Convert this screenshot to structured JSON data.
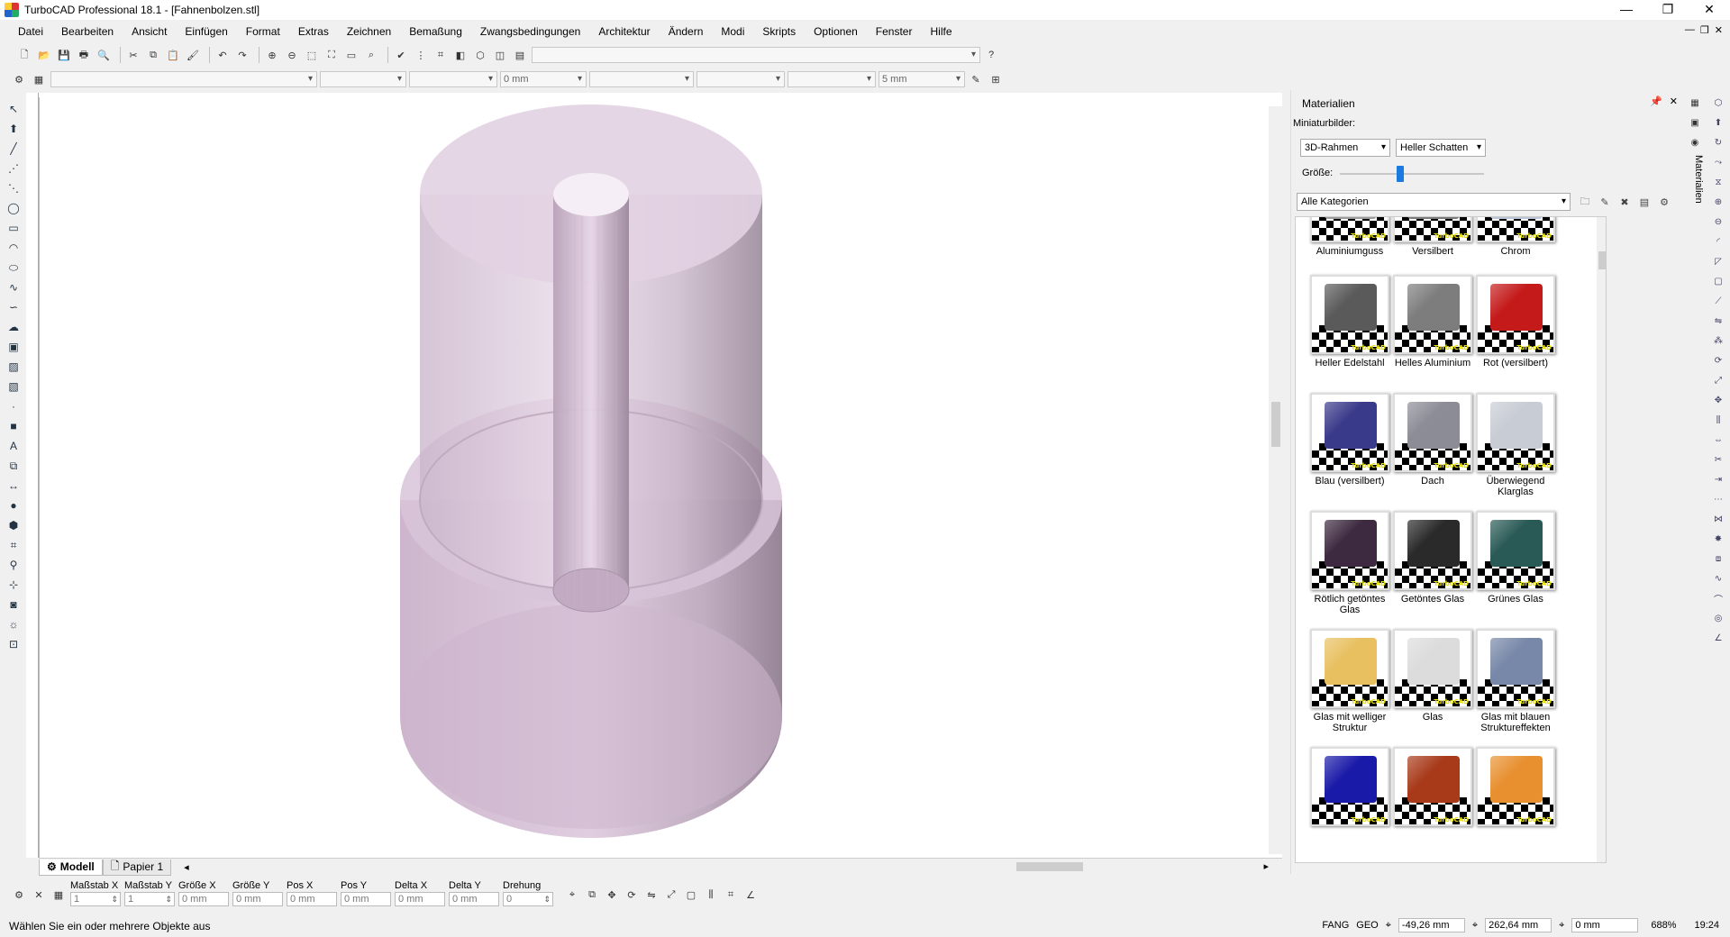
{
  "window": {
    "title": "TurboCAD Professional 18.1 - [Fahnenbolzen.stl]",
    "minimize": "—",
    "maximize": "❐",
    "close": "✕"
  },
  "menu": [
    "Datei",
    "Bearbeiten",
    "Ansicht",
    "Einfügen",
    "Format",
    "Extras",
    "Zeichnen",
    "Bemaßung",
    "Zwangsbedingungen",
    "Architektur",
    "Ändern",
    "Modi",
    "Skripts",
    "Optionen",
    "Fenster",
    "Hilfe"
  ],
  "toolbar2": {
    "offset_value": "0 mm",
    "snap_value": "5 mm"
  },
  "tabs": {
    "model": "Modell",
    "paper": "Papier 1"
  },
  "materials": {
    "title": "Materialien",
    "thumbnails_label": "Miniaturbilder:",
    "frame_option": "3D-Rahmen",
    "shadow_option": "Heller Schatten",
    "size_label": "Größe:",
    "size_fraction": 0.42,
    "category": "Alle Kategorien",
    "vertical_tab": "Materialien",
    "items": [
      {
        "label": "Aluminiumguss",
        "color": "#9a9a9a"
      },
      {
        "label": "Versilbert",
        "color": "#7a7a7a"
      },
      {
        "label": "Chrom",
        "color": "#b8c4d8"
      },
      {
        "label": "Heller Edelstahl",
        "color": "#5a5a5a"
      },
      {
        "label": "Helles Aluminium",
        "color": "#7d7d7d"
      },
      {
        "label": "Rot (versilbert)",
        "color": "#c41a1a"
      },
      {
        "label": "Blau (versilbert)",
        "color": "#3a3a8a"
      },
      {
        "label": "Dach",
        "color": "#8c8c96"
      },
      {
        "label": "Überwiegend Klarglas",
        "color": "#c8ccd4"
      },
      {
        "label": "Rötlich getöntes Glas",
        "color": "#3e2a40"
      },
      {
        "label": "Getöntes Glas",
        "color": "#2a2a2a"
      },
      {
        "label": "Grünes Glas",
        "color": "#2a5a56"
      },
      {
        "label": "Glas mit welliger Struktur",
        "color": "#e8c060"
      },
      {
        "label": "Glas",
        "color": "#dcdcdc"
      },
      {
        "label": "Glas mit blauen Struktureffekten",
        "color": "#7888a8"
      },
      {
        "label": "",
        "color": "#1a1aa8"
      },
      {
        "label": "",
        "color": "#a83a1a"
      },
      {
        "label": "",
        "color": "#e89030"
      }
    ],
    "brand": "TurboCAD"
  },
  "coord_fields": [
    {
      "label": "Maßstab X",
      "value": "1"
    },
    {
      "label": "Maßstab Y",
      "value": "1"
    },
    {
      "label": "Größe X",
      "value": "0 mm"
    },
    {
      "label": "Größe Y",
      "value": "0 mm"
    },
    {
      "label": "Pos X",
      "value": "0 mm"
    },
    {
      "label": "Pos Y",
      "value": "0 mm"
    },
    {
      "label": "Delta X",
      "value": "0 mm"
    },
    {
      "label": "Delta Y",
      "value": "0 mm"
    },
    {
      "label": "Drehung",
      "value": "0"
    }
  ],
  "status": {
    "message": "Wählen Sie ein oder mehrere Objekte aus",
    "snap": "FANG",
    "geo": "GEO",
    "x": "-49,26 mm",
    "y": "262,64 mm",
    "z": "0 mm",
    "zoom": "688%",
    "time": "19:24"
  }
}
